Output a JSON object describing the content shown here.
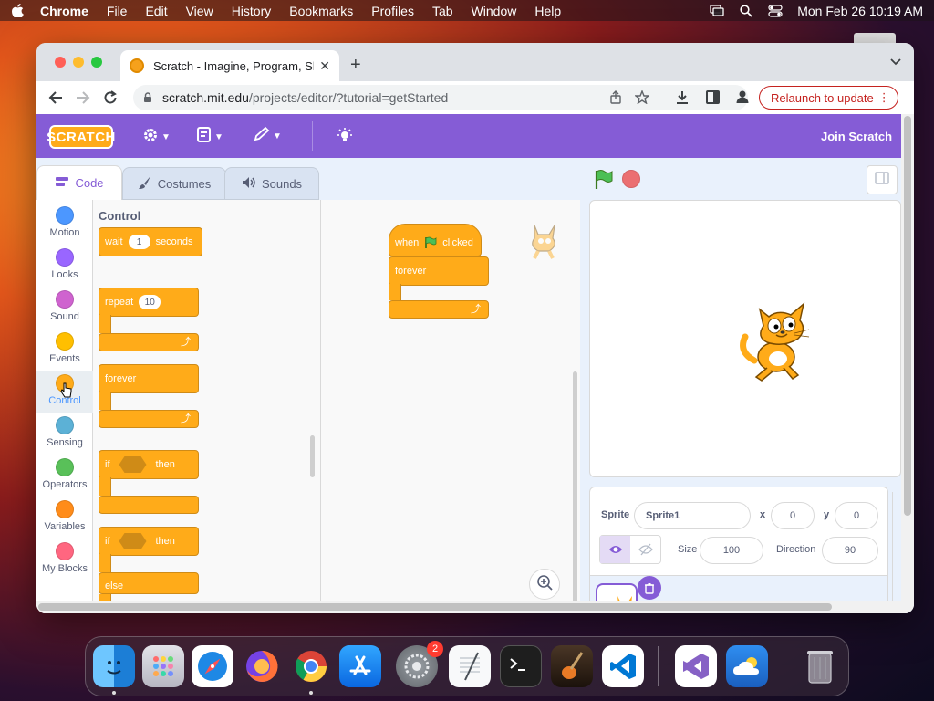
{
  "menubar": {
    "app": "Chrome",
    "items": [
      "File",
      "Edit",
      "View",
      "History",
      "Bookmarks",
      "Profiles",
      "Tab",
      "Window",
      "Help"
    ],
    "clock": "Mon Feb 26  10:19 AM"
  },
  "browser": {
    "tab_title": "Scratch - Imagine, Program, Sh",
    "url_domain": "scratch.mit.edu",
    "url_path": "/projects/editor/?tutorial=getStarted",
    "relaunch_label": "Relaunch to update"
  },
  "scratch": {
    "join_label": "Join Scratch",
    "logo_text": "SCRATCH",
    "tabs": [
      "Code",
      "Costumes",
      "Sounds"
    ],
    "categories": [
      {
        "label": "Motion",
        "color": "#4c97ff"
      },
      {
        "label": "Looks",
        "color": "#9966ff"
      },
      {
        "label": "Sound",
        "color": "#cf63cf"
      },
      {
        "label": "Events",
        "color": "#ffbf00"
      },
      {
        "label": "Control",
        "color": "#ffab19"
      },
      {
        "label": "Sensing",
        "color": "#5cb1d6"
      },
      {
        "label": "Operators",
        "color": "#59c059"
      },
      {
        "label": "Variables",
        "color": "#ff8c1a"
      },
      {
        "label": "My Blocks",
        "color": "#ff6680"
      }
    ],
    "selected_category": "Control",
    "palette": {
      "title": "Control",
      "wait_label": "wait",
      "wait_value": "1",
      "seconds_label": "seconds",
      "repeat_label": "repeat",
      "repeat_value": "10",
      "forever_label": "forever",
      "if_label": "if",
      "then_label": "then",
      "else_label": "else"
    },
    "script": {
      "when_label": "when",
      "clicked_label": "clicked",
      "forever_label": "forever"
    },
    "sprite_info": {
      "sprite_label": "Sprite",
      "sprite_name": "Sprite1",
      "x_label": "x",
      "x_value": "0",
      "y_label": "y",
      "y_value": "0",
      "size_label": "Size",
      "size_value": "100",
      "direction_label": "Direction",
      "direction_value": "90"
    }
  },
  "dock": {
    "apps": [
      "Finder",
      "Launchpad",
      "Safari",
      "Firefox",
      "Chrome",
      "App Store",
      "System Settings",
      "TextEdit",
      "Terminal",
      "GarageBand",
      "Visual Studio Code",
      "Visual Studio",
      "Weather",
      "Trash"
    ],
    "settings_badge": "2"
  }
}
